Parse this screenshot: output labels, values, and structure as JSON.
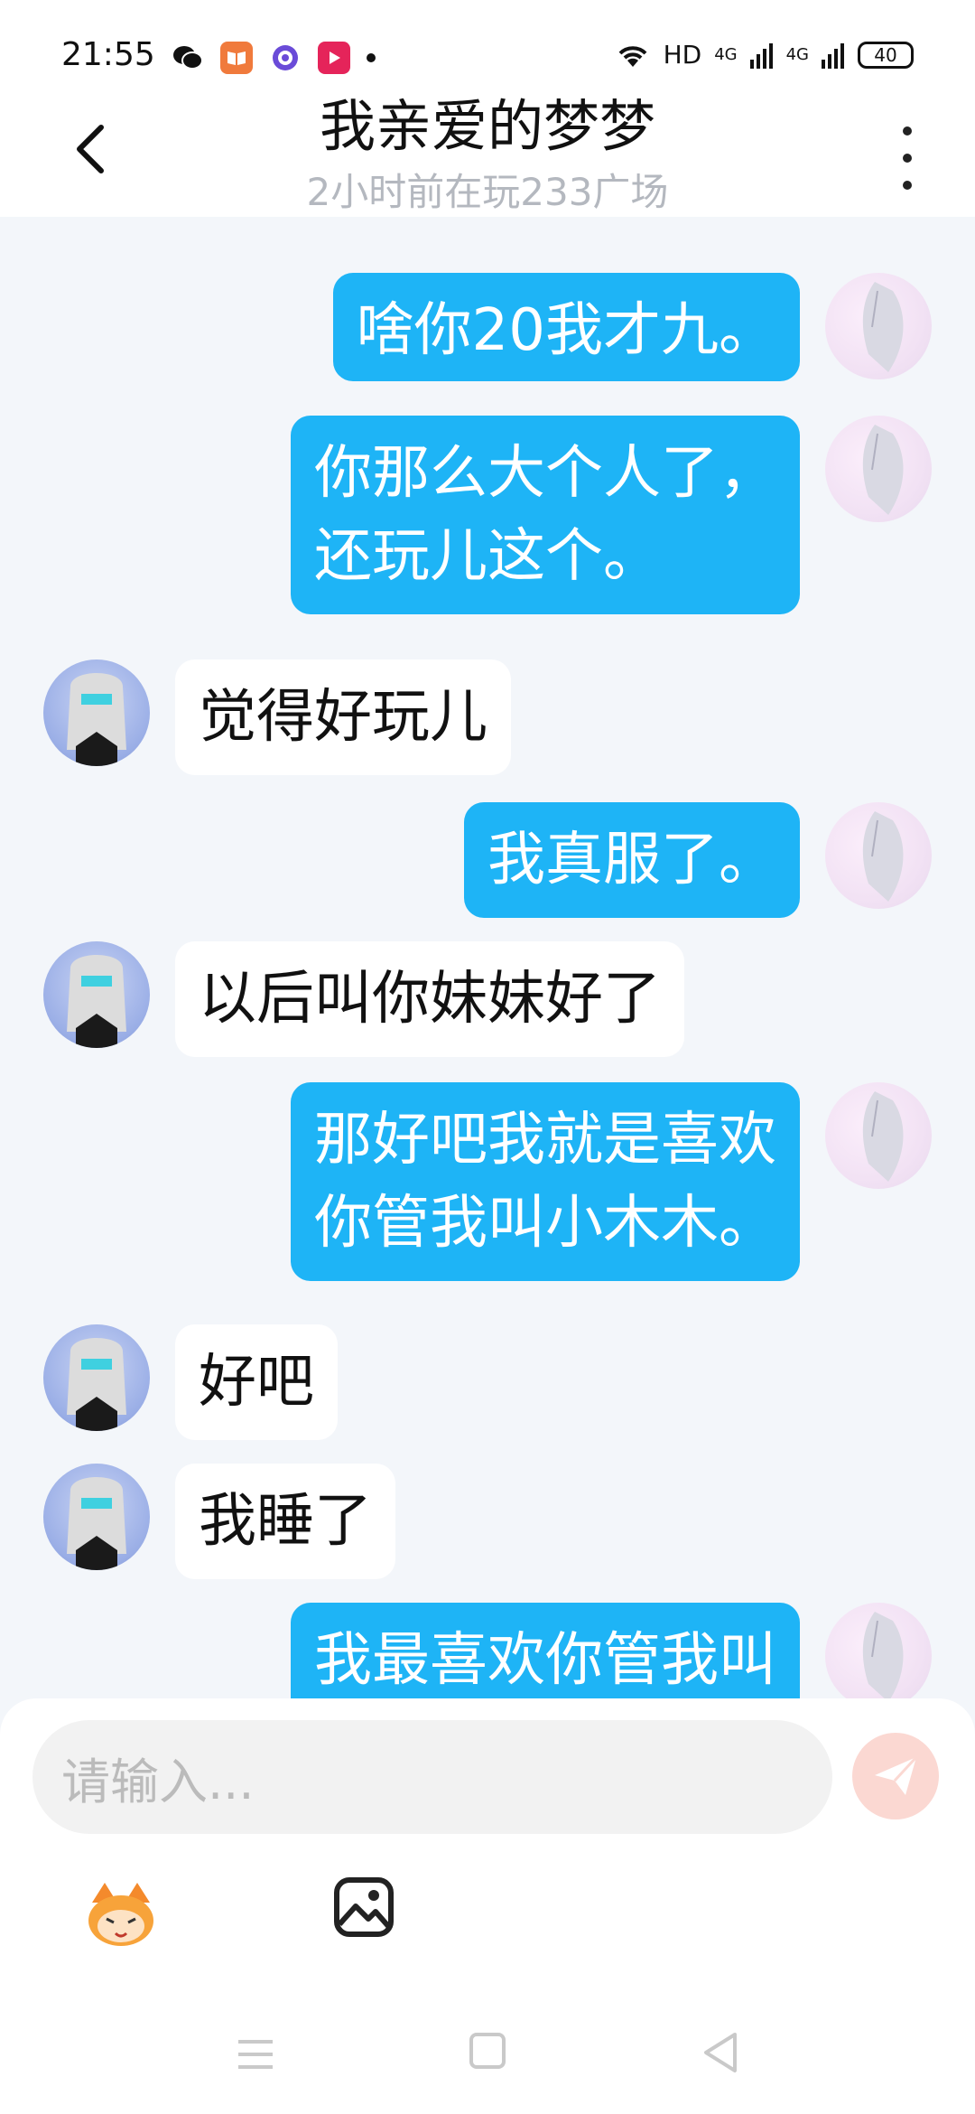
{
  "status_bar": {
    "time": "21:55",
    "network": "HD",
    "signal1": "4G",
    "signal2": "4G",
    "battery": "40",
    "app_icons": [
      "wechat-icon",
      "book-app-icon",
      "browser-app-icon",
      "video-app-icon"
    ]
  },
  "header": {
    "title": "我亲爱的梦梦",
    "subtitle": "2小时前在玩233广场"
  },
  "messages": [
    {
      "side": "me",
      "text": "啥你20我才九。"
    },
    {
      "side": "me",
      "text": "你那么大个人了，\n还玩儿这个。"
    },
    {
      "side": "other",
      "text": "觉得好玩儿"
    },
    {
      "side": "me",
      "text": "我真服了。"
    },
    {
      "side": "other",
      "text": "以后叫你妹妹好了"
    },
    {
      "side": "me",
      "text": "那好吧我就是喜欢\n你管我叫小木木。"
    },
    {
      "side": "other",
      "text": "好吧"
    },
    {
      "side": "other",
      "text": "我睡了"
    },
    {
      "side": "me",
      "text": "我最喜欢你管我叫"
    }
  ],
  "input": {
    "placeholder": "请输入..."
  },
  "colors": {
    "bubble_me": "#1eb4f6",
    "bubble_other": "#ffffff",
    "background": "#f3f6fa",
    "send_button": "#fbd8d2"
  }
}
